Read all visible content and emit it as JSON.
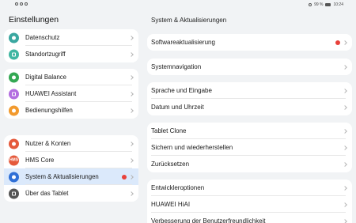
{
  "status": {
    "battery": "99 %",
    "time": "10:24"
  },
  "left": {
    "title": "Einstellungen",
    "groups": [
      [
        {
          "label": "Datenschutz",
          "icon": "privacy-icon",
          "color": "#3aa7a0"
        },
        {
          "label": "Standortzugriff",
          "icon": "location-icon",
          "color": "#40b6a2"
        }
      ],
      [
        {
          "label": "Digital Balance",
          "icon": "digital-balance-icon",
          "color": "#34a853"
        },
        {
          "label": "HUAWEI Assistant",
          "icon": "assistant-icon",
          "color": "#b36ee0"
        },
        {
          "label": "Bedienungshilfen",
          "icon": "accessibility-icon",
          "color": "#f29a2e"
        }
      ],
      [
        {
          "label": "Nutzer & Konten",
          "icon": "user-icon",
          "color": "#e55a3c"
        },
        {
          "label": "HMS Core",
          "icon": "hms-core-icon",
          "color": "#e55a3c",
          "icon_text": "HMS"
        },
        {
          "label": "System & Aktualisierungen",
          "icon": "system-update-icon",
          "color": "#2f6fd6",
          "badge": true,
          "active": true
        },
        {
          "label": "Über das Tablet",
          "icon": "info-icon",
          "color": "#555555"
        }
      ]
    ]
  },
  "right": {
    "title": "System & Aktualisierungen",
    "groups": [
      [
        {
          "label": "Softwareaktualisierung",
          "badge": true
        }
      ],
      [
        {
          "label": "Systemnavigation"
        }
      ],
      [
        {
          "label": "Sprache und Eingabe"
        },
        {
          "label": "Datum und Uhrzeit"
        }
      ],
      [
        {
          "label": "Tablet Clone"
        },
        {
          "label": "Sichern und wiederherstellen"
        },
        {
          "label": "Zurücksetzen"
        }
      ],
      [
        {
          "label": "Entwickleroptionen"
        },
        {
          "label": "HUAWEI HiAI"
        },
        {
          "label": "Verbesserung der Benutzerfreundlichkeit"
        }
      ]
    ]
  }
}
